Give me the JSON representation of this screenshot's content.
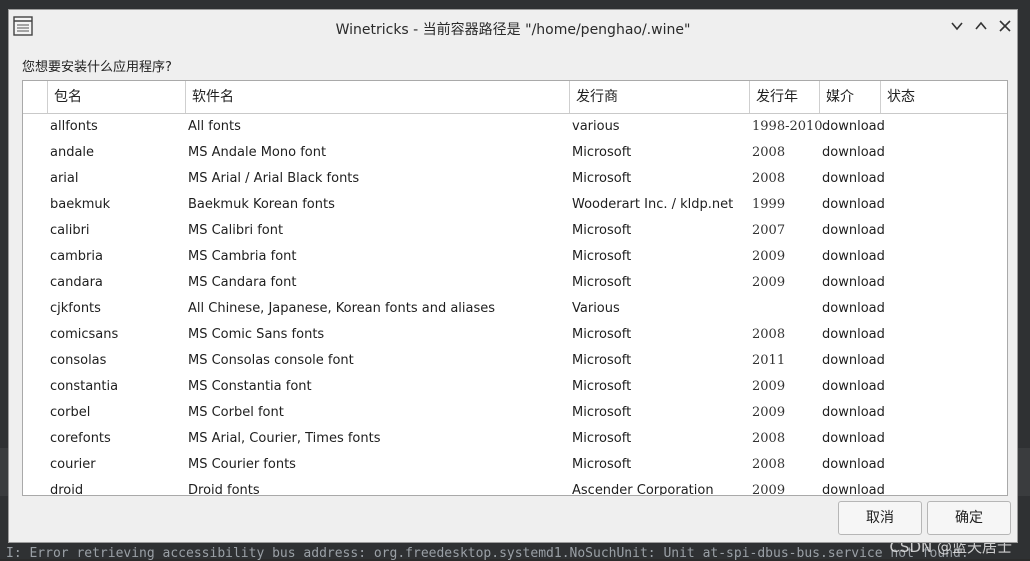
{
  "terminal": {
    "error_line": "I: Error retrieving accessibility bus address: org.freedesktop.systemd1.NoSuchUnit: Unit at-spi-dbus-bus.service not found.",
    "watermark": "CSDN @蓝天居士"
  },
  "window": {
    "title": "Winetricks - 当前容器路径是 \"/home/penghao/.wine\"",
    "icons": [
      "list-app-icon",
      "minimize-icon",
      "maximize-icon",
      "close-icon"
    ]
  },
  "prompt": "您想要安装什么应用程序?",
  "table": {
    "columns": [
      "包名",
      "软件名",
      "发行商",
      "发行年",
      "媒介",
      "状态"
    ],
    "rows": [
      {
        "pkg": "allfonts",
        "name": "All fonts",
        "publisher": "various",
        "year": "1998-2010",
        "media": "download",
        "status": ""
      },
      {
        "pkg": "andale",
        "name": "MS Andale Mono font",
        "publisher": "Microsoft",
        "year": "2008",
        "media": "download",
        "status": ""
      },
      {
        "pkg": "arial",
        "name": "MS Arial / Arial Black fonts",
        "publisher": "Microsoft",
        "year": "2008",
        "media": "download",
        "status": ""
      },
      {
        "pkg": "baekmuk",
        "name": "Baekmuk Korean fonts",
        "publisher": "Wooderart Inc. / kldp.net",
        "year": "1999",
        "media": "download",
        "status": ""
      },
      {
        "pkg": "calibri",
        "name": "MS Calibri font",
        "publisher": "Microsoft",
        "year": "2007",
        "media": "download",
        "status": ""
      },
      {
        "pkg": "cambria",
        "name": "MS Cambria font",
        "publisher": "Microsoft",
        "year": "2009",
        "media": "download",
        "status": ""
      },
      {
        "pkg": "candara",
        "name": "MS Candara font",
        "publisher": "Microsoft",
        "year": "2009",
        "media": "download",
        "status": ""
      },
      {
        "pkg": "cjkfonts",
        "name": "All Chinese, Japanese, Korean fonts and aliases",
        "publisher": "Various",
        "year": "",
        "media": "download",
        "status": ""
      },
      {
        "pkg": "comicsans",
        "name": "MS Comic Sans fonts",
        "publisher": "Microsoft",
        "year": "2008",
        "media": "download",
        "status": ""
      },
      {
        "pkg": "consolas",
        "name": "MS Consolas console font",
        "publisher": "Microsoft",
        "year": "2011",
        "media": "download",
        "status": ""
      },
      {
        "pkg": "constantia",
        "name": "MS Constantia font",
        "publisher": "Microsoft",
        "year": "2009",
        "media": "download",
        "status": ""
      },
      {
        "pkg": "corbel",
        "name": "MS Corbel font",
        "publisher": "Microsoft",
        "year": "2009",
        "media": "download",
        "status": ""
      },
      {
        "pkg": "corefonts",
        "name": "MS Arial, Courier, Times fonts",
        "publisher": "Microsoft",
        "year": "2008",
        "media": "download",
        "status": ""
      },
      {
        "pkg": "courier",
        "name": "MS Courier fonts",
        "publisher": "Microsoft",
        "year": "2008",
        "media": "download",
        "status": ""
      },
      {
        "pkg": "droid",
        "name": "Droid fonts",
        "publisher": "Ascender Corporation",
        "year": "2009",
        "media": "download",
        "status": ""
      }
    ]
  },
  "buttons": {
    "cancel": "取消",
    "ok": "确定"
  },
  "colors": {
    "dialog_bg": "#efefef",
    "list_bg": "#ffffff",
    "terminal_bg": "#2f3133"
  }
}
